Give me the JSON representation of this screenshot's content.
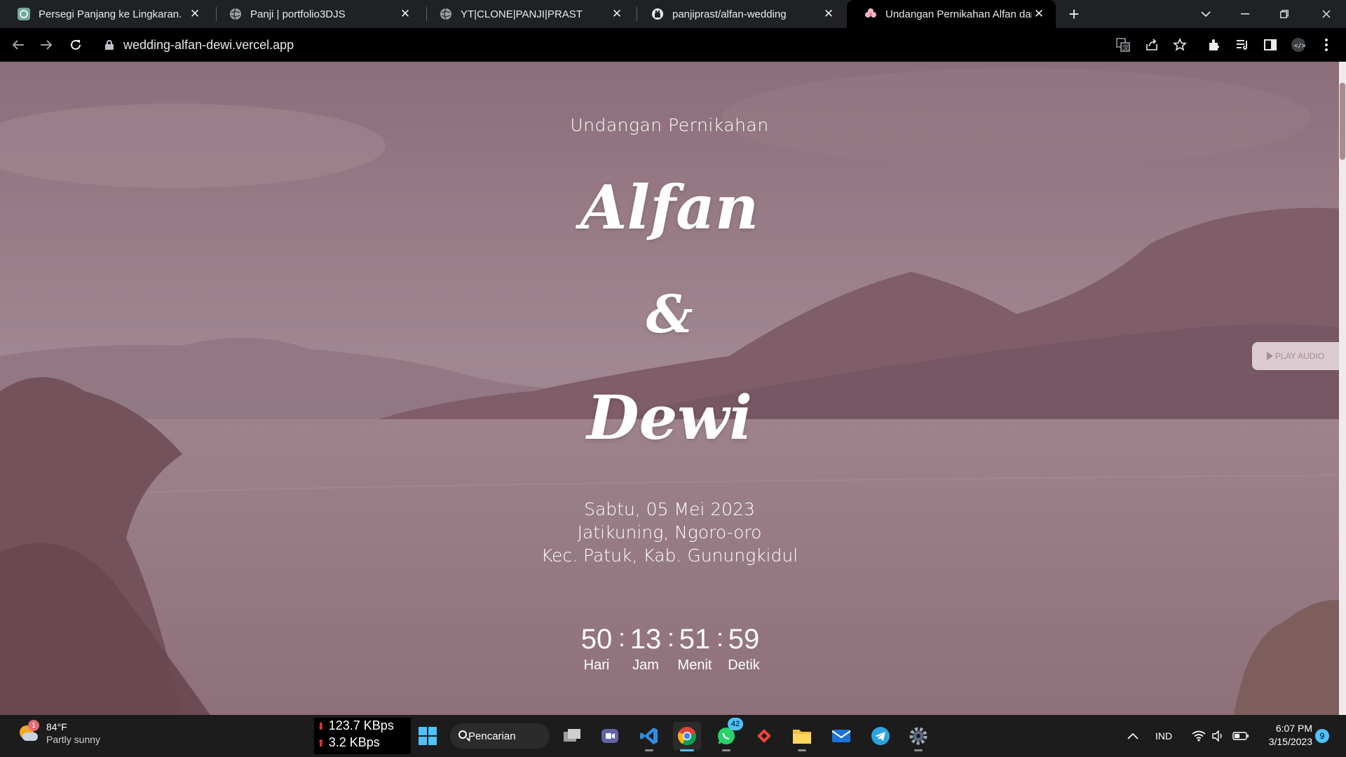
{
  "browser": {
    "tabs": [
      {
        "title": "Persegi Panjang ke Lingkaran.",
        "favicon": "chatgpt-icon"
      },
      {
        "title": "Panji | portfolio3DJS",
        "favicon": "globe-icon"
      },
      {
        "title": "YT|CLONE|PANJI|PRAST",
        "favicon": "globe-icon"
      },
      {
        "title": "panjiprast/alfan-wedding",
        "favicon": "github-icon"
      },
      {
        "title": "Undangan Pernikahan Alfan dan",
        "favicon": "flower-icon",
        "active": true
      }
    ],
    "close_glyph": "✕",
    "new_tab_glyph": "+",
    "url": "wedding-alfan-dewi.vercel.app"
  },
  "page": {
    "title": "Undangan Pernikahan",
    "groom": "Alfan",
    "ampersand": "&",
    "bride": "Dewi",
    "date": "Sabtu, 05 Mei 2023",
    "location_line1": "Jatikuning, Ngoro-oro",
    "location_line2": "Kec. Patuk, Kab. Gunungkidul",
    "countdown": [
      {
        "value": "50",
        "label": "Hari"
      },
      {
        "value": "13",
        "label": "Jam"
      },
      {
        "value": "51",
        "label": "Menit"
      },
      {
        "value": "59",
        "label": "Detik"
      }
    ],
    "countdown_separator": ":",
    "play_audio_label": "PLAY AUDIO",
    "overlay_color": "#8a6a76"
  },
  "taskbar": {
    "weather_temp": "84°F",
    "weather_desc": "Partly sunny",
    "weather_badge": "1",
    "net_down": "123.7 KBps",
    "net_up": "3.2 KBps",
    "search_label": "Pencarian",
    "whatsapp_badge": "42",
    "language": "IND",
    "time": "6:07 PM",
    "date": "3/15/2023",
    "notification_count": "9"
  }
}
